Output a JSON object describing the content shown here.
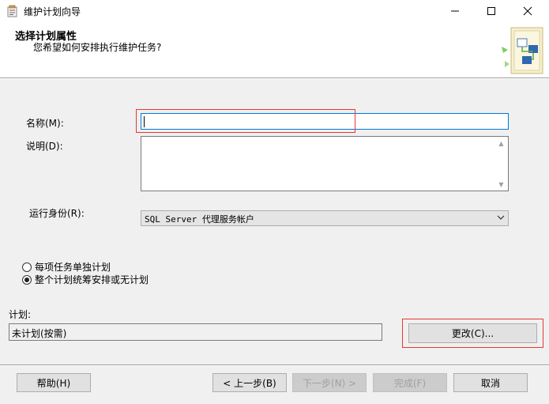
{
  "window": {
    "title": "维护计划向导",
    "minimize_icon": "minimize-icon",
    "maximize_icon": "maximize-icon",
    "close_icon": "close-icon"
  },
  "header": {
    "title": "选择计划属性",
    "subtitle": "您希望如何安排执行维护任务?",
    "graphic_icon": "wizard-graphic-icon"
  },
  "form": {
    "name_label": "名称(M):",
    "name_value": "",
    "description_label": "说明(D):",
    "description_value": "",
    "run_as_label": "运行身份(R):",
    "run_as_value": "SQL Server 代理服务帐户"
  },
  "schedule_options": [
    {
      "label": "每项任务单独计划",
      "selected": false
    },
    {
      "label": "整个计划统筹安排或无计划",
      "selected": true
    }
  ],
  "schedule": {
    "label": "计划:",
    "value": "未计划(按需)",
    "change_button": "更改(C)..."
  },
  "footer": {
    "help_button": "帮助(H)",
    "back_button": "< 上一步(B)",
    "next_button": "下一步(N) >",
    "finish_button": "完成(F)",
    "cancel_button": "取消"
  },
  "colors": {
    "focus_border": "#0078d7",
    "annotation_box": "#e53935",
    "dialog_bg": "#f0f0f0"
  }
}
